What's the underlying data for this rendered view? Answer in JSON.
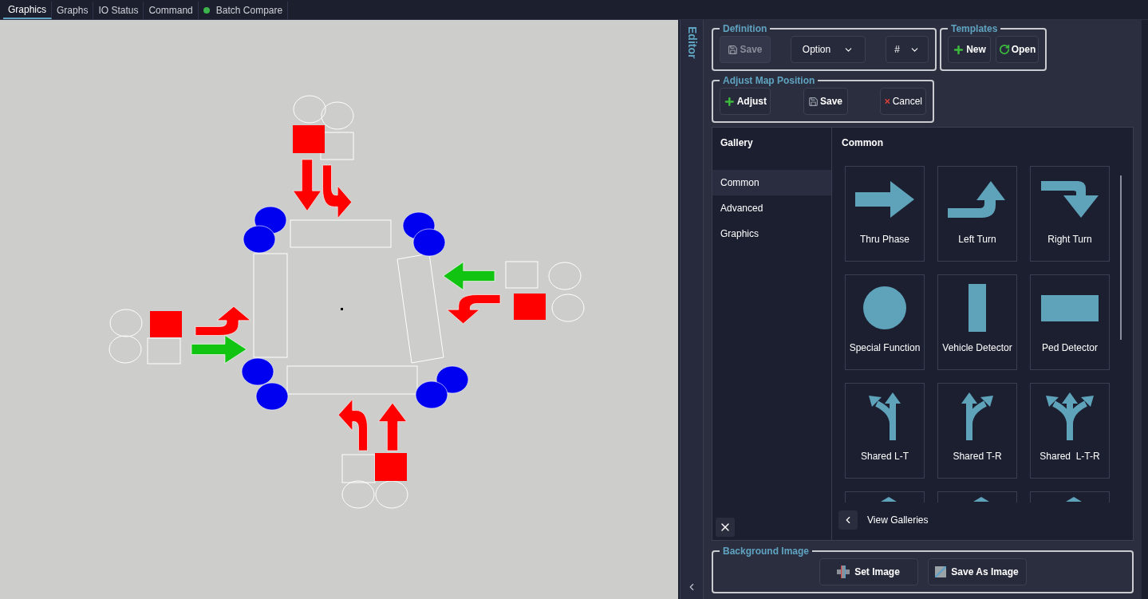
{
  "tabs": [
    {
      "label": "Graphics",
      "selected": true
    },
    {
      "label": "Graphs",
      "selected": false
    },
    {
      "label": "IO Status",
      "selected": false
    },
    {
      "label": "Command",
      "selected": false
    },
    {
      "label": "Batch Compare",
      "selected": false,
      "color": "#3cb44b"
    }
  ],
  "map": {
    "arrows": [
      {
        "kind": "left-turn",
        "color": "#ff0000"
      },
      {
        "kind": "through",
        "color": "#11c411"
      },
      {
        "kind": "through",
        "color": "#ff0000"
      },
      {
        "kind": "left-turn",
        "color": "#ff0000"
      },
      {
        "kind": "through",
        "color": "#11c411"
      },
      {
        "kind": "left-turn",
        "color": "#ff0000"
      },
      {
        "kind": "through",
        "color": "#ff0000"
      },
      {
        "kind": "left-turn",
        "color": "#ff0000"
      }
    ]
  },
  "editor": {
    "title": "Editor",
    "definition": {
      "title": "Definition",
      "save": {
        "label": "Save",
        "disabled": true
      },
      "option_select": "Option",
      "number_select": "#"
    },
    "templates": {
      "title": "Templates",
      "buttons": [
        {
          "kind": "new",
          "label": "New"
        },
        {
          "kind": "open",
          "label": "Open"
        }
      ]
    },
    "adjust": {
      "title": "Adjust Map Position",
      "buttons": [
        {
          "kind": "add",
          "label": "Adjust"
        },
        {
          "kind": "save",
          "label": "Save"
        },
        {
          "kind": "cancel",
          "label": "Cancel"
        }
      ]
    },
    "gallery": {
      "title": "Gallery",
      "categories": [
        {
          "label": "Common",
          "selected": true
        },
        {
          "label": "Advanced",
          "selected": false
        },
        {
          "label": "Graphics",
          "selected": false
        }
      ],
      "section_title": "Common",
      "items": [
        {
          "kind": "thru",
          "label": "Thru Phase"
        },
        {
          "kind": "left",
          "label": "Left Turn"
        },
        {
          "kind": "right",
          "label": "Right Turn"
        },
        {
          "kind": "circle",
          "label": "Special Function"
        },
        {
          "kind": "vbar",
          "label": "Vehicle Detector"
        },
        {
          "kind": "hbar",
          "label": "Ped Detector"
        },
        {
          "kind": "shared-lt",
          "label": "Shared L-T"
        },
        {
          "kind": "shared-tr",
          "label": "Shared T-R"
        },
        {
          "kind": "shared-ltr",
          "label": "Shared  L-T-R"
        },
        {
          "kind": "cut"
        },
        {
          "kind": "cut"
        },
        {
          "kind": "cut"
        }
      ],
      "back_label": "View Galleries"
    },
    "background_image": {
      "title": "Background Image",
      "buttons": [
        {
          "kind": "set",
          "label": "Set Image"
        },
        {
          "kind": "save-image",
          "label": "Save As Image"
        }
      ]
    }
  }
}
